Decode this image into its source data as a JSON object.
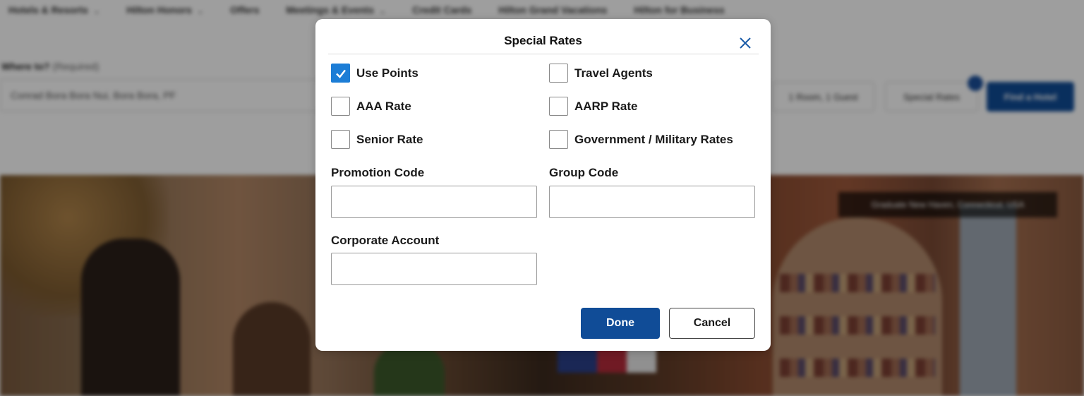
{
  "background": {
    "nav": [
      {
        "label": "Hotels & Resorts",
        "dropdown": true
      },
      {
        "label": "Hilton Honors",
        "dropdown": true
      },
      {
        "label": "Offers",
        "dropdown": false
      },
      {
        "label": "Meetings & Events",
        "dropdown": true
      },
      {
        "label": "Credit Cards",
        "dropdown": false
      },
      {
        "label": "Hilton Grand Vacations",
        "dropdown": false
      },
      {
        "label": "Hilton for Business",
        "dropdown": false
      }
    ],
    "search": {
      "label": "Where to?",
      "required": "(Required)",
      "value": "Conrad Bora Bora Nui, Bora Bora, PF",
      "rooms": "1 Room, 1 Guest",
      "special_rates": "Special Rates",
      "find": "Find a Hotel"
    },
    "hero_caption": "Graduate New Haven, Connecticut, USA"
  },
  "dialog": {
    "title": "Special Rates",
    "checkboxes": [
      {
        "label": "Use Points",
        "checked": true
      },
      {
        "label": "Travel Agents",
        "checked": false
      },
      {
        "label": "AAA Rate",
        "checked": false
      },
      {
        "label": "AARP Rate",
        "checked": false
      },
      {
        "label": "Senior Rate",
        "checked": false
      },
      {
        "label": "Government / Military Rates",
        "checked": false
      }
    ],
    "fields": {
      "promotion_code": {
        "label": "Promotion Code",
        "value": ""
      },
      "group_code": {
        "label": "Group Code",
        "value": ""
      },
      "corporate_account": {
        "label": "Corporate Account",
        "value": ""
      }
    },
    "done_label": "Done",
    "cancel_label": "Cancel"
  },
  "colors": {
    "primary": "#104c97",
    "checkbox_checked": "#1c7dd6",
    "close_icon": "#1a5ba8"
  }
}
